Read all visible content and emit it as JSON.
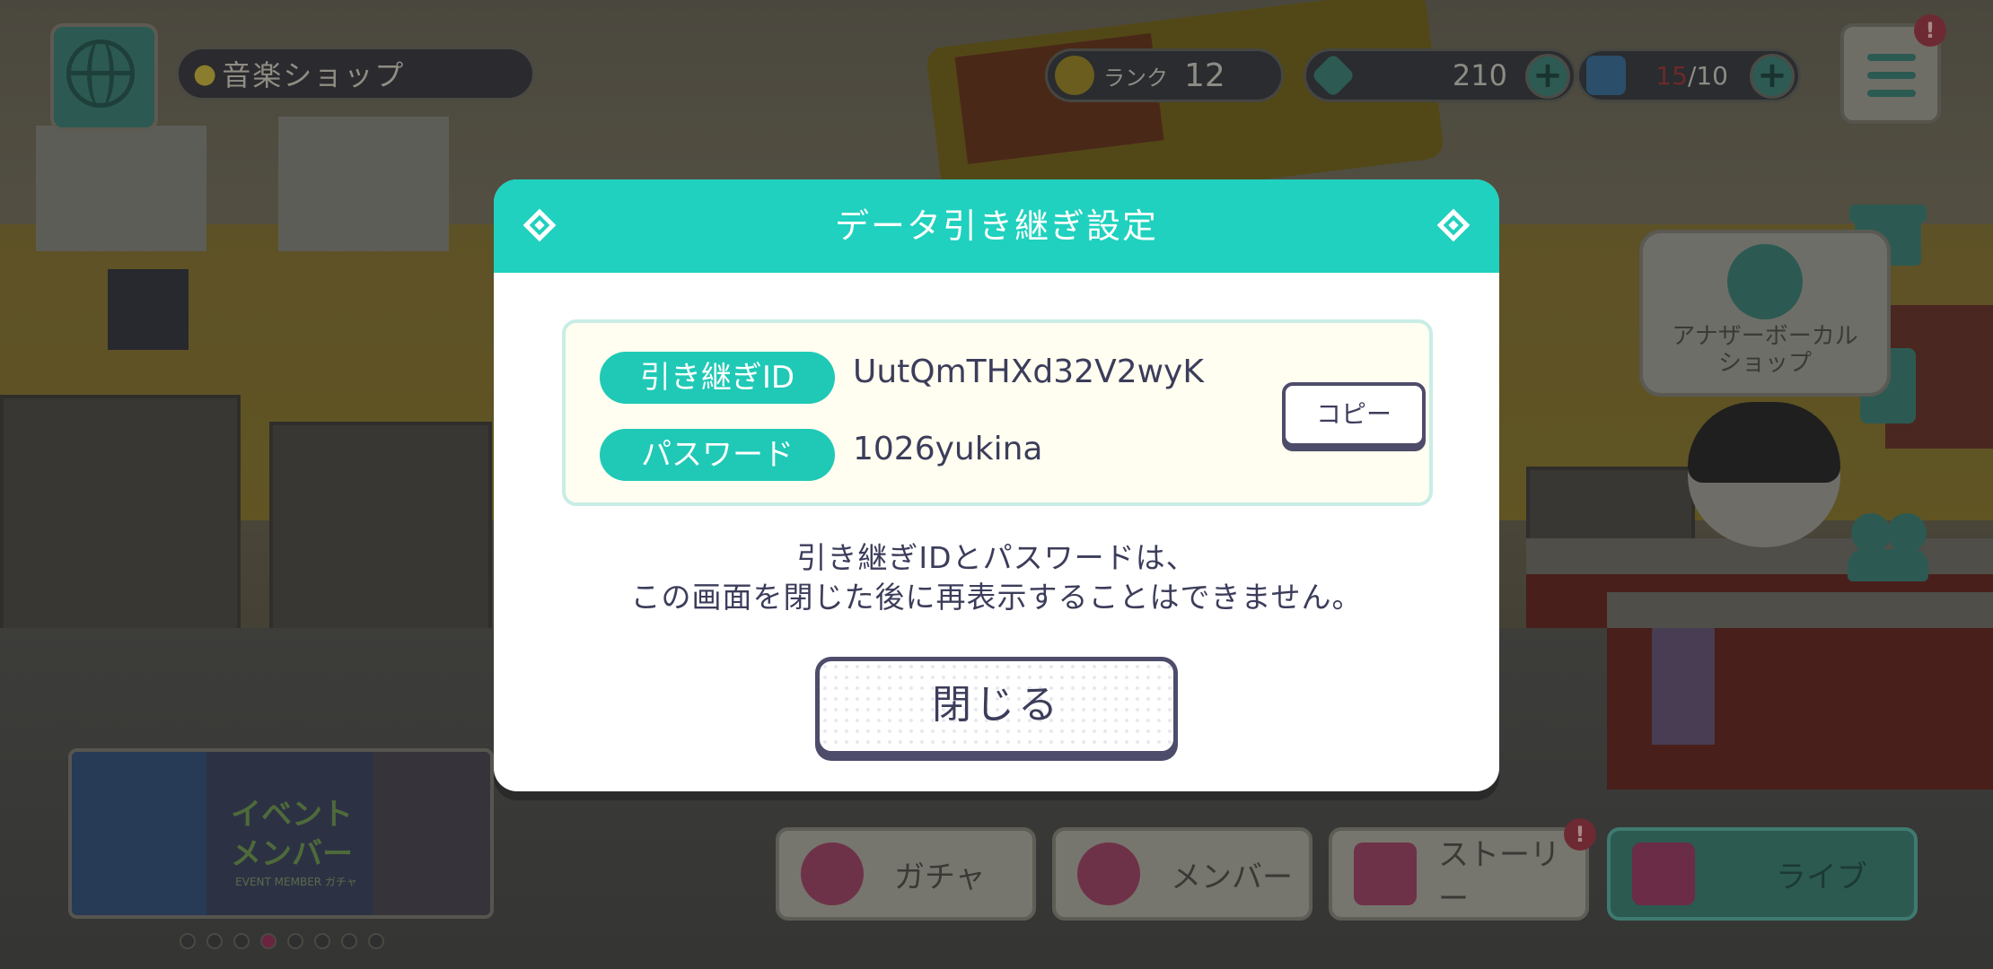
{
  "hud": {
    "location": "音楽ショップ",
    "rank_label": "ランク",
    "rank_value": "12",
    "gems": "210",
    "live_current": "15",
    "live_max": "/10",
    "menu_badge": "!"
  },
  "bubble": {
    "label_line1": "アナザーボーカル",
    "label_line2": "ショップ"
  },
  "event_banner": {
    "title_line1": "イベント",
    "title_line2": "メンバー",
    "subtitle": "EVENT MEMBER ガチャ",
    "active_dot_index": 3,
    "dot_count": 8
  },
  "nav": {
    "gacha": "ガチャ",
    "member": "メンバー",
    "story": "ストーリー",
    "story_badge": "!",
    "live": "ライブ"
  },
  "modal": {
    "title": "データ引き継ぎ設定",
    "id_label": "引き継ぎID",
    "id_value": "UutQmTHXd32V2wyK",
    "password_label": "パスワード",
    "password_value": "1026yukina",
    "copy_label": "コピー",
    "notice_line1": "引き継ぎIDとパスワードは、",
    "notice_line2": "この画面を閉じた後に再表示することはできません。",
    "close_label": "閉じる"
  },
  "colors": {
    "header_teal": "#1fd1be",
    "label_teal": "#1fc9b6",
    "text_navy": "#3c3d5b",
    "box_cream": "#fffef0"
  }
}
